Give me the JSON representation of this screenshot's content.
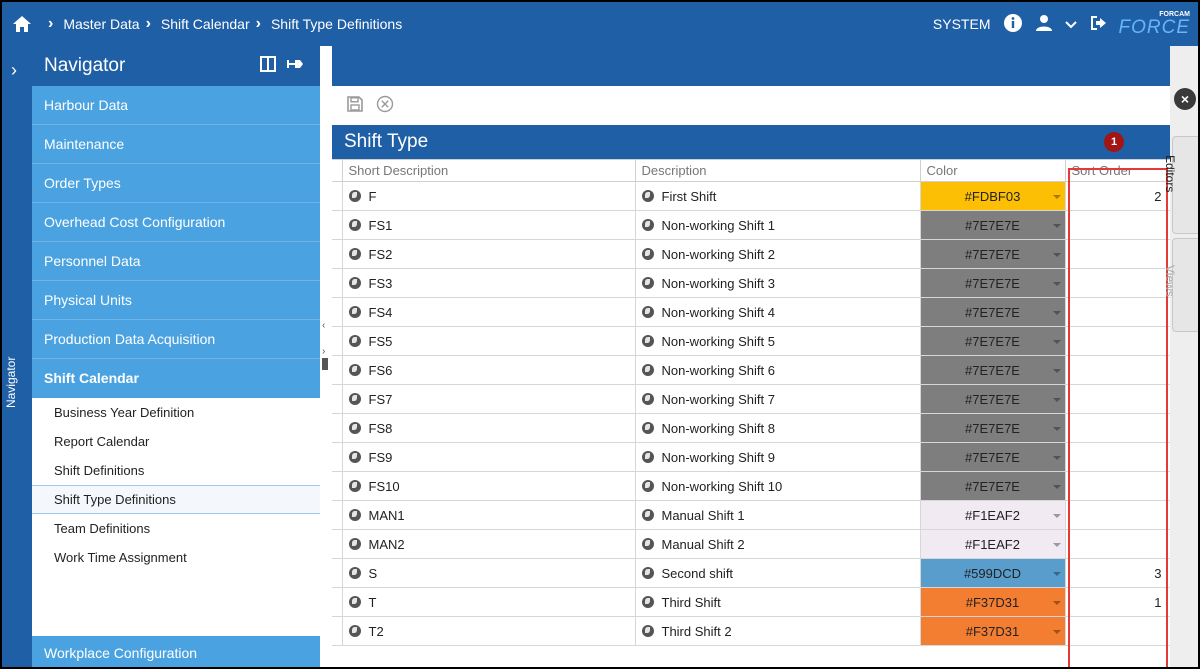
{
  "breadcrumb": [
    "Master Data",
    "Shift Calendar",
    "Shift Type Definitions"
  ],
  "top_right": {
    "user": "SYSTEM",
    "logo_small": "FORCAM",
    "logo_big": "FORCE"
  },
  "rail": {
    "label": "Navigator"
  },
  "navigator": {
    "title": "Navigator",
    "items": [
      "Harbour Data",
      "Maintenance",
      "Order Types",
      "Overhead Cost Configuration",
      "Personnel Data",
      "Physical Units",
      "Production Data Acquisition",
      "Shift Calendar"
    ],
    "sub_items": [
      "Business Year Definition",
      "Report Calendar",
      "Shift Definitions",
      "Shift Type Definitions",
      "Team Definitions",
      "Work Time Assignment"
    ],
    "selected_sub_item": "Shift Type Definitions",
    "bottom_item": "Workplace Configuration"
  },
  "grid": {
    "title": "Shift Type",
    "badge": "1",
    "columns": [
      "Short Description",
      "Description",
      "Color",
      "Sort Order"
    ],
    "rows": [
      {
        "short": "F",
        "desc": "First Shift",
        "color": "#FDBF03",
        "sort": "2"
      },
      {
        "short": "FS1",
        "desc": "Non-working Shift 1",
        "color": "#7E7E7E",
        "sort": ""
      },
      {
        "short": "FS2",
        "desc": "Non-working Shift 2",
        "color": "#7E7E7E",
        "sort": ""
      },
      {
        "short": "FS3",
        "desc": "Non-working Shift 3",
        "color": "#7E7E7E",
        "sort": ""
      },
      {
        "short": "FS4",
        "desc": "Non-working Shift 4",
        "color": "#7E7E7E",
        "sort": ""
      },
      {
        "short": "FS5",
        "desc": "Non-working Shift 5",
        "color": "#7E7E7E",
        "sort": ""
      },
      {
        "short": "FS6",
        "desc": "Non-working Shift 6",
        "color": "#7E7E7E",
        "sort": ""
      },
      {
        "short": "FS7",
        "desc": "Non-working Shift 7",
        "color": "#7E7E7E",
        "sort": ""
      },
      {
        "short": "FS8",
        "desc": "Non-working Shift 8",
        "color": "#7E7E7E",
        "sort": ""
      },
      {
        "short": "FS9",
        "desc": "Non-working Shift 9",
        "color": "#7E7E7E",
        "sort": ""
      },
      {
        "short": "FS10",
        "desc": "Non-working Shift 10",
        "color": "#7E7E7E",
        "sort": ""
      },
      {
        "short": "MAN1",
        "desc": "Manual Shift 1",
        "color": "#F1EAF2",
        "sort": ""
      },
      {
        "short": "MAN2",
        "desc": "Manual Shift 2",
        "color": "#F1EAF2",
        "sort": ""
      },
      {
        "short": "S",
        "desc": "Second shift",
        "color": "#599DCD",
        "sort": "3"
      },
      {
        "short": "T",
        "desc": "Third Shift",
        "color": "#F37D31",
        "sort": "1"
      },
      {
        "short": "T2",
        "desc": "Third Shift 2",
        "color": "#F37D31",
        "sort": ""
      }
    ]
  },
  "right_tabs": [
    "Editors",
    "Views"
  ],
  "colors": {
    "brand_blue": "#1f5fa6",
    "nav_blue": "#4aa3e0",
    "highlight_red": "#e53935"
  }
}
